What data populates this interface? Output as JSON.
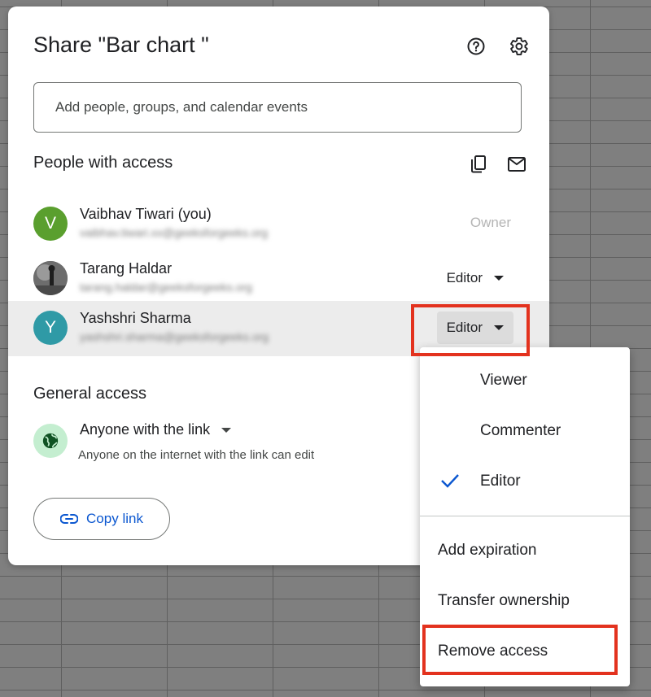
{
  "dialog": {
    "title": "Share \"Bar chart \"",
    "help_icon": "help-circle-icon",
    "settings_icon": "gear-icon"
  },
  "add_people": {
    "placeholder": "Add people, groups, and calendar events"
  },
  "people_section": {
    "title": "People with access",
    "copy_icon": "copy-emails-icon",
    "email_icon": "email-icon",
    "people": [
      {
        "initial": "V",
        "name": "Vaibhav Tiwari (you)",
        "role": "Owner",
        "avatar_color": "#5a9f2e"
      },
      {
        "initial": "",
        "name": "Tarang Haldar",
        "role": "Editor",
        "avatar_color": "#3c3c3c"
      },
      {
        "initial": "Y",
        "name": "Yashshri Sharma",
        "role": "Editor",
        "avatar_color": "#2f9aa6"
      }
    ]
  },
  "general_access": {
    "title": "General access",
    "globe_icon": "globe-icon",
    "link_option": "Anyone with the link",
    "description": "Anyone on the internet with the link can edit"
  },
  "copy_link": {
    "label": "Copy link",
    "icon": "link-icon"
  },
  "role_menu": {
    "roles": [
      "Viewer",
      "Commenter",
      "Editor"
    ],
    "selected": "Editor",
    "actions": [
      "Add expiration",
      "Transfer ownership",
      "Remove access"
    ]
  },
  "colors": {
    "accent_blue": "#0b57d0",
    "highlight_red": "#e3321e",
    "globe_bg": "#c4eed0"
  }
}
